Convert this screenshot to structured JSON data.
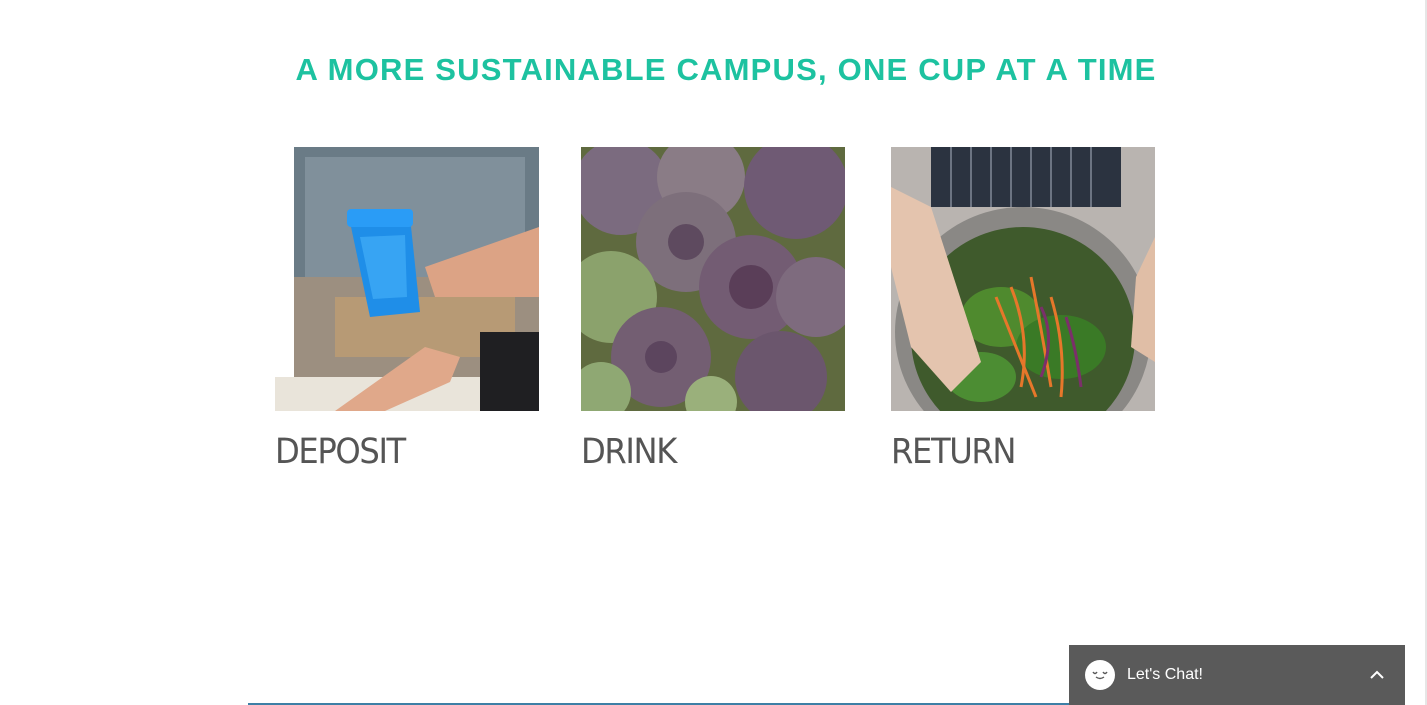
{
  "section": {
    "headline": "A MORE SUSTAINABLE CAMPUS, ONE CUP AT A TIME"
  },
  "cards": [
    {
      "label": "DEPOSIT",
      "image": "blue-cup-handoff-photo"
    },
    {
      "label": "DRINK",
      "image": "artichokes-photo"
    },
    {
      "label": "RETURN",
      "image": "salad-bowl-photo"
    }
  ],
  "chat": {
    "label": "Let's Chat!",
    "icon": "chat-bubble-icon",
    "toggle_icon": "chevron-up-icon"
  },
  "colors": {
    "accent": "#1dc2a0",
    "label_text": "#555555",
    "chat_background": "#5a5a5a"
  }
}
